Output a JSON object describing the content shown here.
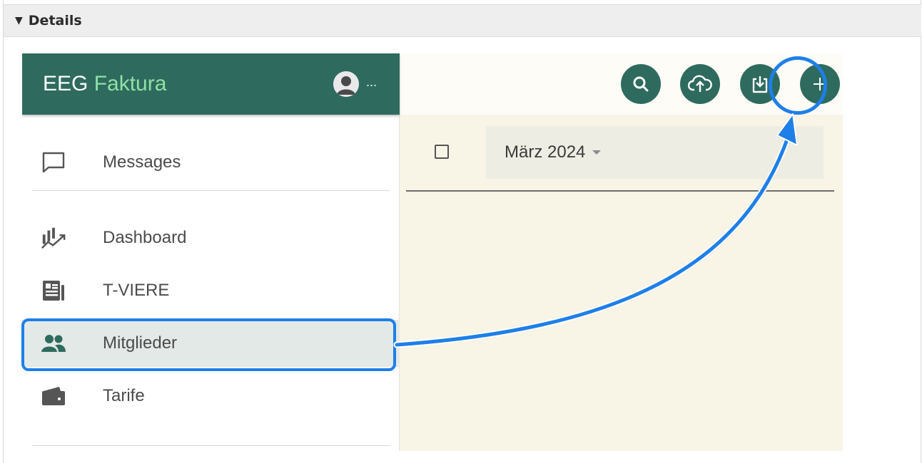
{
  "details": {
    "label": "Details",
    "toggle": "▼"
  },
  "app": {
    "brand_prefix": "EEG",
    "brand_suffix": "Faktura",
    "user_menu": "...",
    "colors": {
      "primary": "#2e6b5e",
      "accent_text": "#8fe0a6",
      "highlight": "#1e7fe8"
    }
  },
  "sidebar": {
    "items": [
      {
        "label": "Messages",
        "icon": "message-icon"
      },
      {
        "label": "Dashboard",
        "icon": "chart-icon"
      },
      {
        "label": "T-VIERE",
        "icon": "newspaper-icon"
      },
      {
        "label": "Mitglieder",
        "icon": "members-icon",
        "active": true
      },
      {
        "label": "Tarife",
        "icon": "wallet-icon"
      }
    ]
  },
  "toolbar": {
    "buttons": [
      "search-icon",
      "cloud-upload-icon",
      "download-icon",
      "add-icon"
    ]
  },
  "content": {
    "period": "März 2024"
  }
}
